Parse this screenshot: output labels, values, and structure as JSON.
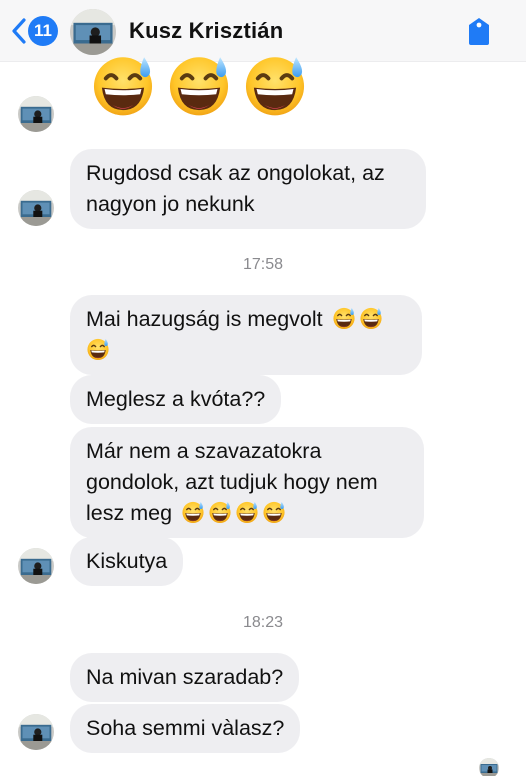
{
  "header": {
    "back_count": "11",
    "contact_name": "Kusz Krisztián",
    "icons": {
      "back": "chevron-left-icon",
      "tag": "tag-icon"
    },
    "accent_color": "#1f7bf6"
  },
  "messages": {
    "big_emoji": [
      "grinning-sweat-emoji",
      "grinning-sweat-emoji",
      "grinning-sweat-emoji"
    ],
    "m1": {
      "line1": "Rugdosd csak az ongolokat, az",
      "line2": "nagyon jo nekunk"
    },
    "time1": "17:58",
    "m2": {
      "line1": "Mai hazugság is megvolt"
    },
    "m3": {
      "text": "Meglesz a kvóta??"
    },
    "m4": {
      "line1": "Már nem a szavazatokra",
      "line2": "gondolok, azt tudjuk hogy nem",
      "line3": "lesz meg"
    },
    "m5": {
      "text": "Kiskutya"
    },
    "time2": "18:23",
    "m6": {
      "text": "Na mivan szaradab?"
    },
    "m7": {
      "text": "Soha semmi vàlasz?"
    }
  },
  "colors": {
    "bubble": "#eeeef1",
    "timestamp": "#8a8a8e"
  }
}
